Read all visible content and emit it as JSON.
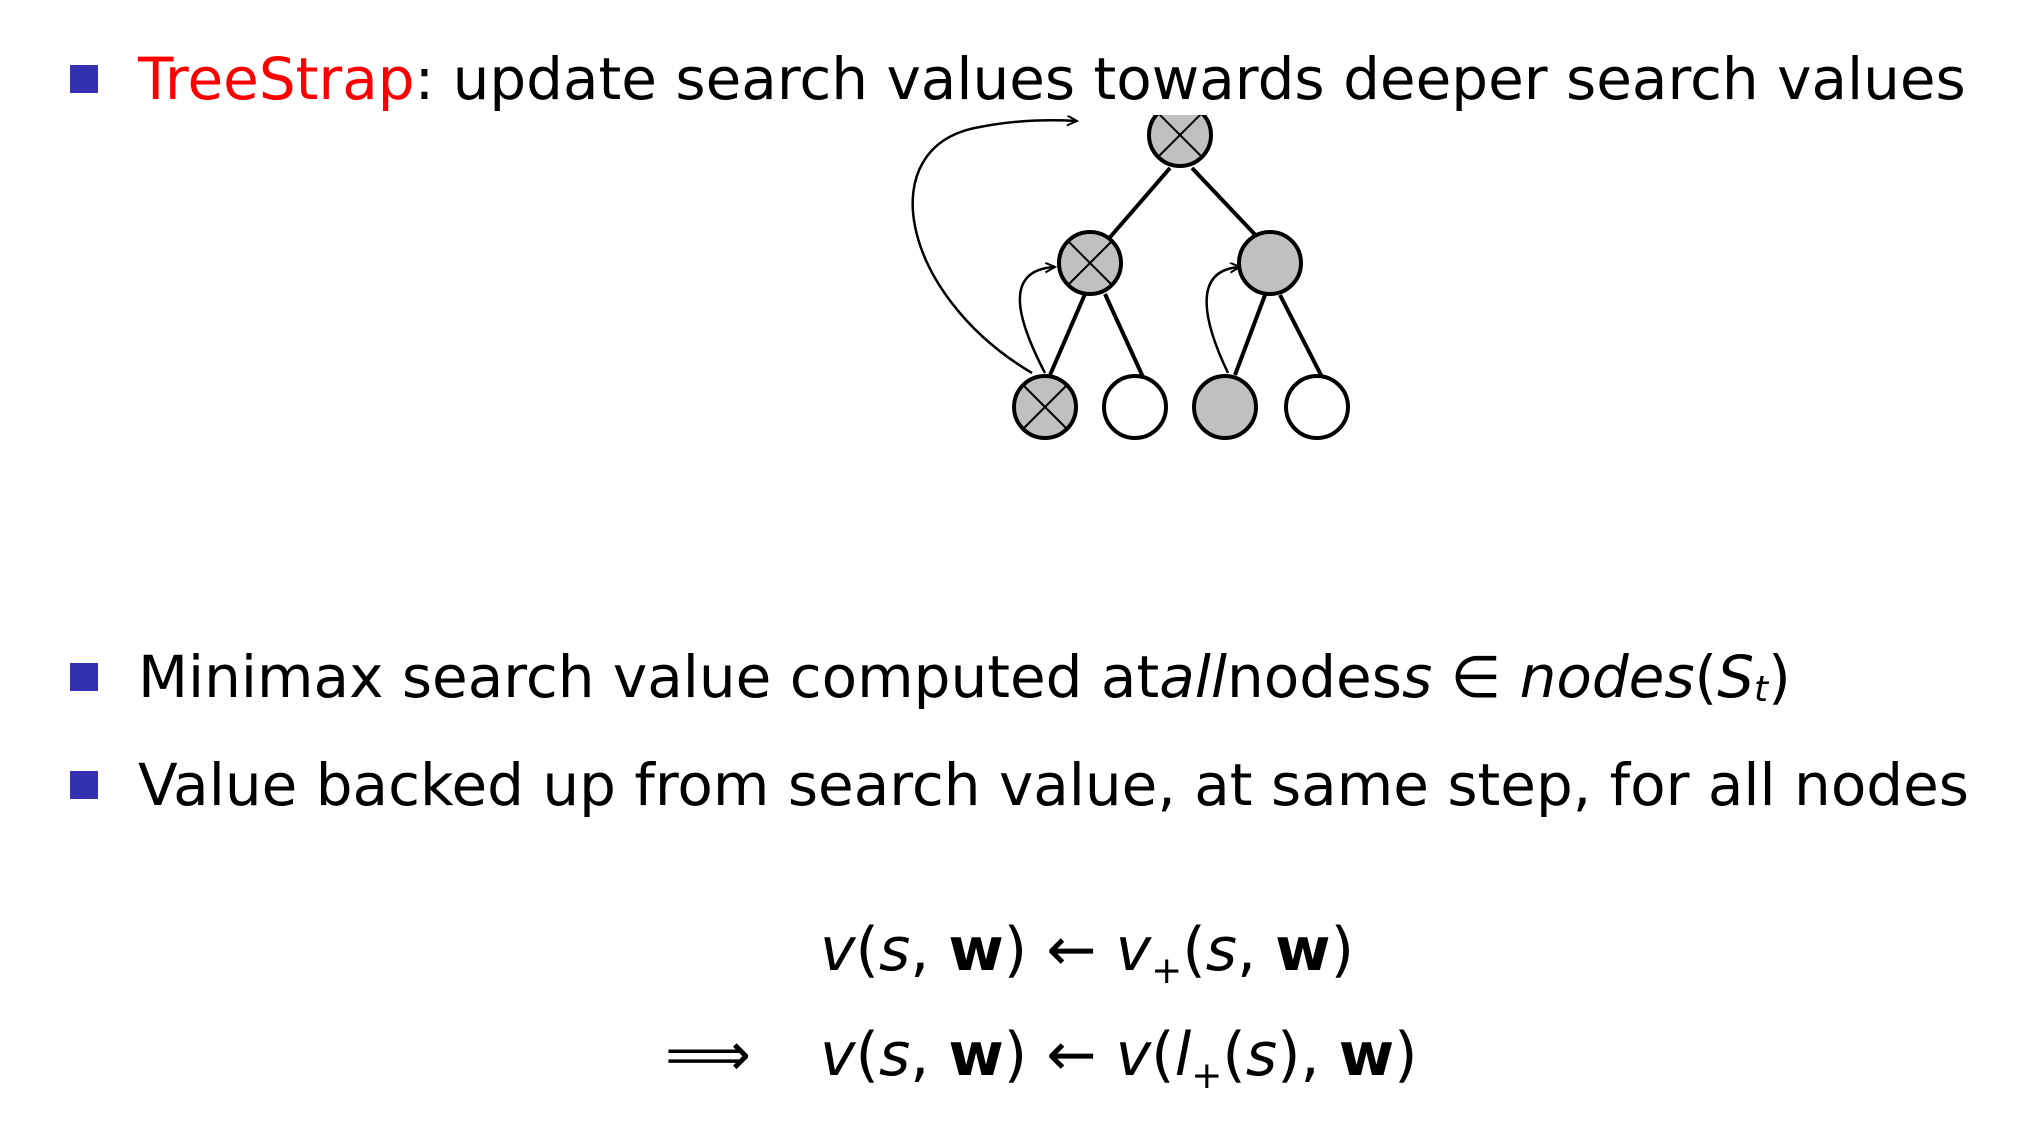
{
  "bullets": [
    {
      "term": "TreeStrap",
      "rest": ": update search values towards deeper search values"
    },
    {
      "text_before": "Minimax search value computed at ",
      "emphasis": "all",
      "text_after": " nodes ",
      "math_var": "s",
      "math_in": " ∈ ",
      "math_func": "nodes",
      "math_arg_open": "(",
      "math_arg": "S",
      "math_arg_sub": "t",
      "math_arg_close": ")"
    },
    {
      "text": "Value backed up from search value, at same step, for all nodes"
    }
  ],
  "equations": {
    "line1": {
      "lhs_v": "v",
      "lhs_open": "(",
      "lhs_s": "s",
      "lhs_comma": ", ",
      "lhs_w": "w",
      "lhs_close": ")",
      "arrow": " ← ",
      "rhs_v": "v",
      "rhs_sub": "+",
      "rhs_open": "(",
      "rhs_s": "s",
      "rhs_comma": ", ",
      "rhs_w": "w",
      "rhs_close": ")"
    },
    "line2": {
      "implies": "⟹",
      "lhs_v": "v",
      "lhs_open": "(",
      "lhs_s": "s",
      "lhs_comma": ", ",
      "lhs_w": "w",
      "lhs_close": ")",
      "arrow": " ← ",
      "rhs_v": "v",
      "rhs_open": "(",
      "rhs_l": "l",
      "rhs_sub": "+",
      "rhs_inner_open": "(",
      "rhs_s": "s",
      "rhs_inner_close": ")",
      "rhs_comma": ", ",
      "rhs_w": "w",
      "rhs_close": ")"
    }
  },
  "colors": {
    "bullet": "#3333b2",
    "highlight": "#ff0000",
    "node_filled": "#c0c0c0",
    "node_empty": "#ffffff"
  },
  "tree": {
    "nodes": [
      {
        "id": "root",
        "fill": "grey",
        "crossed": true
      },
      {
        "id": "left-mid",
        "fill": "grey",
        "crossed": true
      },
      {
        "id": "right-mid",
        "fill": "grey",
        "crossed": false
      },
      {
        "id": "leaf-1",
        "fill": "grey",
        "crossed": true
      },
      {
        "id": "leaf-2",
        "fill": "white",
        "crossed": false
      },
      {
        "id": "leaf-3",
        "fill": "grey",
        "crossed": false
      },
      {
        "id": "leaf-4",
        "fill": "white",
        "crossed": false
      }
    ]
  }
}
